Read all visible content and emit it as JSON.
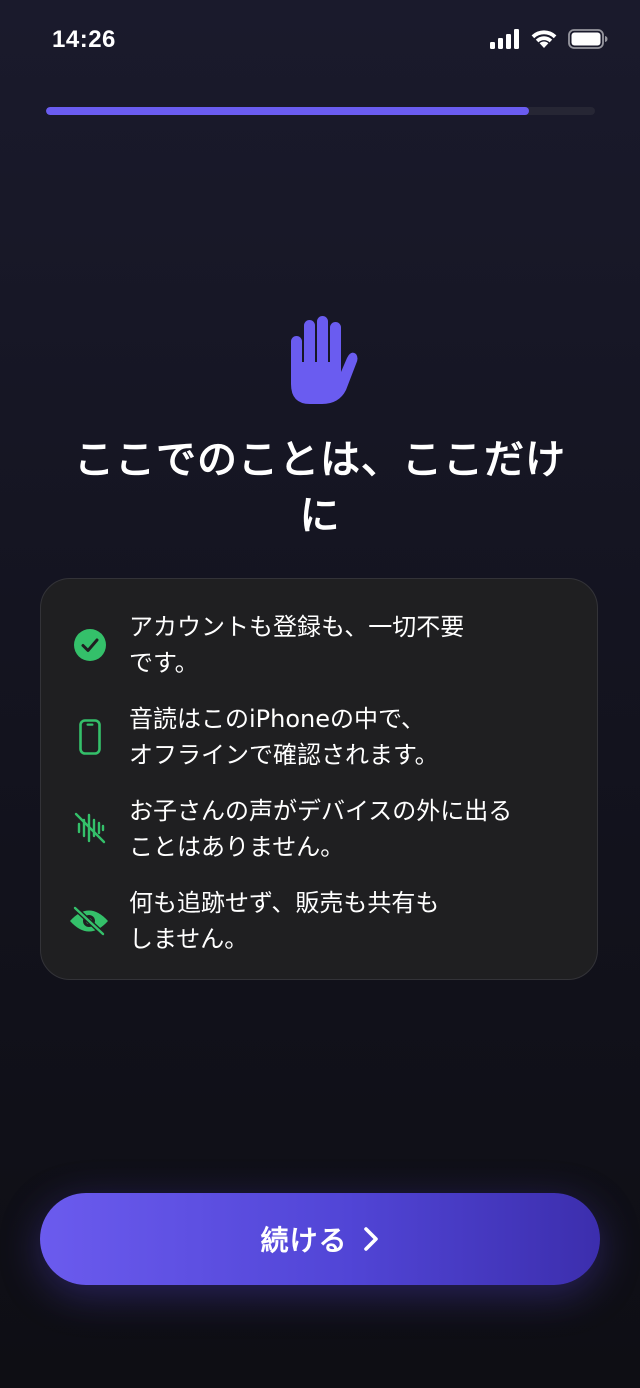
{
  "status_bar": {
    "time": "14:26"
  },
  "progress": {
    "fraction": 0.88
  },
  "hero": {
    "icon": "hand-raised-icon",
    "title": "ここでのことは、ここだけ\nに"
  },
  "privacy_items": [
    {
      "icon": "check-circle-icon",
      "text": "アカウントも登録も、一切不要\nです。"
    },
    {
      "icon": "iphone-icon",
      "text": "音読はこのiPhoneの中で、\nオフラインで確認されます。"
    },
    {
      "icon": "waveform-slash-icon",
      "text": "お子さんの声がデバイスの外に出る\nことはありません。"
    },
    {
      "icon": "eye-slash-icon",
      "text": "何も追跡せず、販売も共有も\nしません。"
    }
  ],
  "continue_button": {
    "label": "続ける",
    "icon": "chevron-right-icon"
  },
  "colors": {
    "accent": "#6a5cf0",
    "icon_green": "#34c06a",
    "card_background": "#1f1f21"
  }
}
